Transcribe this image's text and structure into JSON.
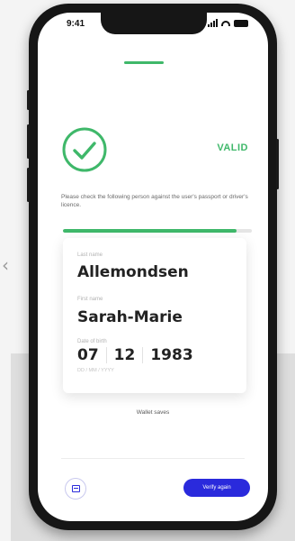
{
  "status_bar": {
    "time": "9:41"
  },
  "result": {
    "status_label": "VALID",
    "instruction": "Please check the following person against the user's passport or driver's licence.",
    "progress": 0.92
  },
  "card": {
    "fields": [
      {
        "label": "Last name",
        "value": "Allemondsen"
      },
      {
        "label": "First name",
        "value": "Sarah-Marie"
      },
      {
        "label": "Date of birth"
      }
    ],
    "dob": {
      "day": "07",
      "month": "12",
      "year": "1983",
      "sub_label": "DD / MM / YYYY"
    }
  },
  "footer": {
    "link_text": "Wallet saves",
    "primary_button": "Verify again",
    "menu_icon": "card-icon"
  },
  "colors": {
    "valid_green": "#3fb86a",
    "primary_blue": "#2a2adc"
  }
}
